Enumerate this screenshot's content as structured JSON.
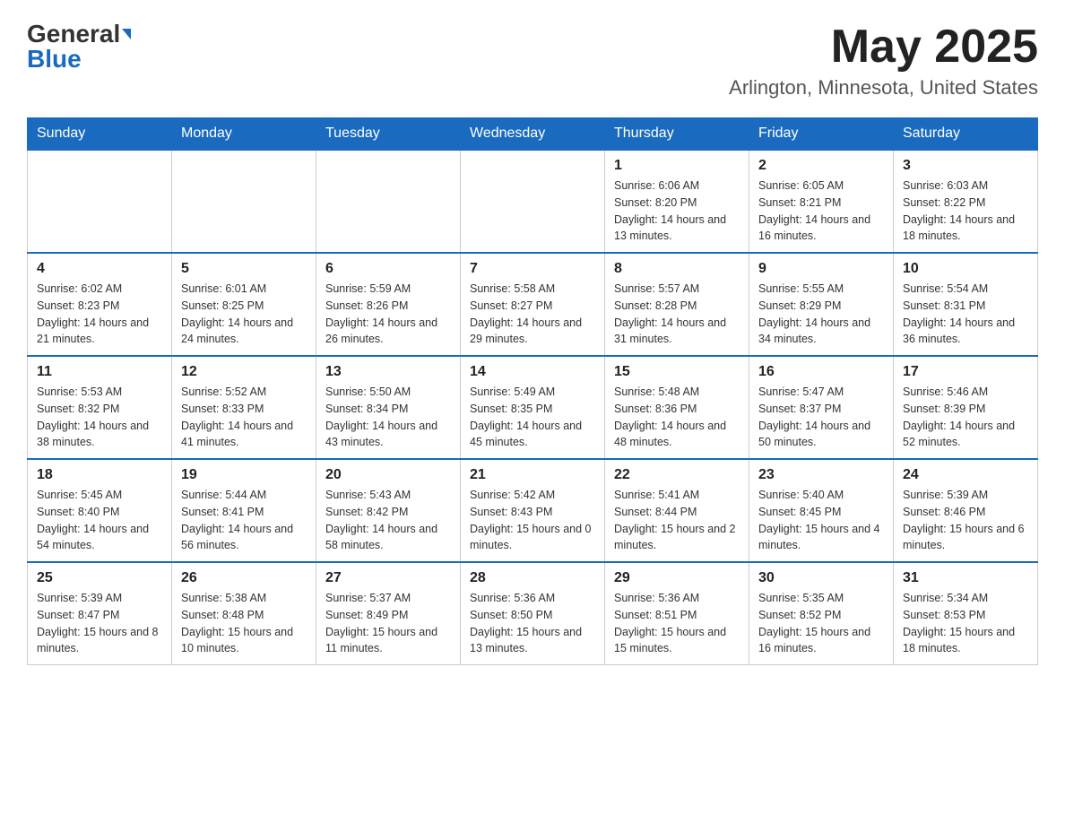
{
  "header": {
    "logo_general": "General",
    "logo_blue": "Blue",
    "month": "May 2025",
    "location": "Arlington, Minnesota, United States"
  },
  "weekdays": [
    "Sunday",
    "Monday",
    "Tuesday",
    "Wednesday",
    "Thursday",
    "Friday",
    "Saturday"
  ],
  "weeks": [
    [
      {
        "day": "",
        "info": ""
      },
      {
        "day": "",
        "info": ""
      },
      {
        "day": "",
        "info": ""
      },
      {
        "day": "",
        "info": ""
      },
      {
        "day": "1",
        "info": "Sunrise: 6:06 AM\nSunset: 8:20 PM\nDaylight: 14 hours and 13 minutes."
      },
      {
        "day": "2",
        "info": "Sunrise: 6:05 AM\nSunset: 8:21 PM\nDaylight: 14 hours and 16 minutes."
      },
      {
        "day": "3",
        "info": "Sunrise: 6:03 AM\nSunset: 8:22 PM\nDaylight: 14 hours and 18 minutes."
      }
    ],
    [
      {
        "day": "4",
        "info": "Sunrise: 6:02 AM\nSunset: 8:23 PM\nDaylight: 14 hours and 21 minutes."
      },
      {
        "day": "5",
        "info": "Sunrise: 6:01 AM\nSunset: 8:25 PM\nDaylight: 14 hours and 24 minutes."
      },
      {
        "day": "6",
        "info": "Sunrise: 5:59 AM\nSunset: 8:26 PM\nDaylight: 14 hours and 26 minutes."
      },
      {
        "day": "7",
        "info": "Sunrise: 5:58 AM\nSunset: 8:27 PM\nDaylight: 14 hours and 29 minutes."
      },
      {
        "day": "8",
        "info": "Sunrise: 5:57 AM\nSunset: 8:28 PM\nDaylight: 14 hours and 31 minutes."
      },
      {
        "day": "9",
        "info": "Sunrise: 5:55 AM\nSunset: 8:29 PM\nDaylight: 14 hours and 34 minutes."
      },
      {
        "day": "10",
        "info": "Sunrise: 5:54 AM\nSunset: 8:31 PM\nDaylight: 14 hours and 36 minutes."
      }
    ],
    [
      {
        "day": "11",
        "info": "Sunrise: 5:53 AM\nSunset: 8:32 PM\nDaylight: 14 hours and 38 minutes."
      },
      {
        "day": "12",
        "info": "Sunrise: 5:52 AM\nSunset: 8:33 PM\nDaylight: 14 hours and 41 minutes."
      },
      {
        "day": "13",
        "info": "Sunrise: 5:50 AM\nSunset: 8:34 PM\nDaylight: 14 hours and 43 minutes."
      },
      {
        "day": "14",
        "info": "Sunrise: 5:49 AM\nSunset: 8:35 PM\nDaylight: 14 hours and 45 minutes."
      },
      {
        "day": "15",
        "info": "Sunrise: 5:48 AM\nSunset: 8:36 PM\nDaylight: 14 hours and 48 minutes."
      },
      {
        "day": "16",
        "info": "Sunrise: 5:47 AM\nSunset: 8:37 PM\nDaylight: 14 hours and 50 minutes."
      },
      {
        "day": "17",
        "info": "Sunrise: 5:46 AM\nSunset: 8:39 PM\nDaylight: 14 hours and 52 minutes."
      }
    ],
    [
      {
        "day": "18",
        "info": "Sunrise: 5:45 AM\nSunset: 8:40 PM\nDaylight: 14 hours and 54 minutes."
      },
      {
        "day": "19",
        "info": "Sunrise: 5:44 AM\nSunset: 8:41 PM\nDaylight: 14 hours and 56 minutes."
      },
      {
        "day": "20",
        "info": "Sunrise: 5:43 AM\nSunset: 8:42 PM\nDaylight: 14 hours and 58 minutes."
      },
      {
        "day": "21",
        "info": "Sunrise: 5:42 AM\nSunset: 8:43 PM\nDaylight: 15 hours and 0 minutes."
      },
      {
        "day": "22",
        "info": "Sunrise: 5:41 AM\nSunset: 8:44 PM\nDaylight: 15 hours and 2 minutes."
      },
      {
        "day": "23",
        "info": "Sunrise: 5:40 AM\nSunset: 8:45 PM\nDaylight: 15 hours and 4 minutes."
      },
      {
        "day": "24",
        "info": "Sunrise: 5:39 AM\nSunset: 8:46 PM\nDaylight: 15 hours and 6 minutes."
      }
    ],
    [
      {
        "day": "25",
        "info": "Sunrise: 5:39 AM\nSunset: 8:47 PM\nDaylight: 15 hours and 8 minutes."
      },
      {
        "day": "26",
        "info": "Sunrise: 5:38 AM\nSunset: 8:48 PM\nDaylight: 15 hours and 10 minutes."
      },
      {
        "day": "27",
        "info": "Sunrise: 5:37 AM\nSunset: 8:49 PM\nDaylight: 15 hours and 11 minutes."
      },
      {
        "day": "28",
        "info": "Sunrise: 5:36 AM\nSunset: 8:50 PM\nDaylight: 15 hours and 13 minutes."
      },
      {
        "day": "29",
        "info": "Sunrise: 5:36 AM\nSunset: 8:51 PM\nDaylight: 15 hours and 15 minutes."
      },
      {
        "day": "30",
        "info": "Sunrise: 5:35 AM\nSunset: 8:52 PM\nDaylight: 15 hours and 16 minutes."
      },
      {
        "day": "31",
        "info": "Sunrise: 5:34 AM\nSunset: 8:53 PM\nDaylight: 15 hours and 18 minutes."
      }
    ]
  ]
}
